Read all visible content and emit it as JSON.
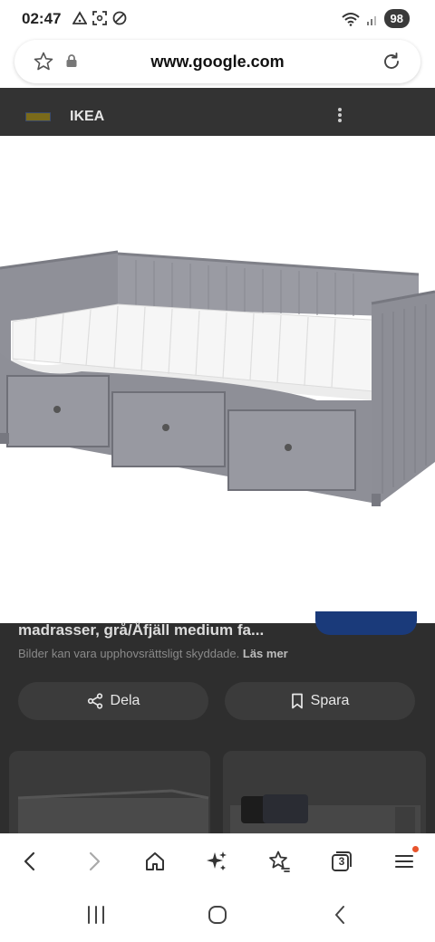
{
  "status_bar": {
    "time": "02:47",
    "battery": "98",
    "icons": [
      "warning-triangle-icon",
      "screenshot-icon",
      "no-sim-icon",
      "wifi-icon",
      "signal-icon"
    ]
  },
  "url_bar": {
    "url": "www.google.com",
    "icons": [
      "star-icon",
      "lock-icon",
      "reload-icon"
    ]
  },
  "site": {
    "name": "IKEA",
    "logo_label": "IKEA"
  },
  "result": {
    "title_fragment": "madrasser, grå/Åfjäll medium fa...",
    "copyright_text": "Bilder kan vara upphovsrättsligt skyddade.",
    "copyright_link": "Läs mer"
  },
  "actions": {
    "share_label": "Dela",
    "save_label": "Spara"
  },
  "toolbar": {
    "tabs_count": "3",
    "icons": [
      "back-icon",
      "forward-icon",
      "home-icon",
      "sparkle-icon",
      "bookmarks-icon",
      "tabs-icon",
      "menu-icon"
    ]
  },
  "nav": {
    "icons": [
      "recents-icon",
      "home-circle-icon",
      "system-back-icon"
    ]
  },
  "colors": {
    "dim_background": "#2e2e2e",
    "bed_frame": "#8e8f97",
    "mattress": "#f4f4f4",
    "accent_blue": "#1a3a7a",
    "notification": "#e8542c"
  }
}
